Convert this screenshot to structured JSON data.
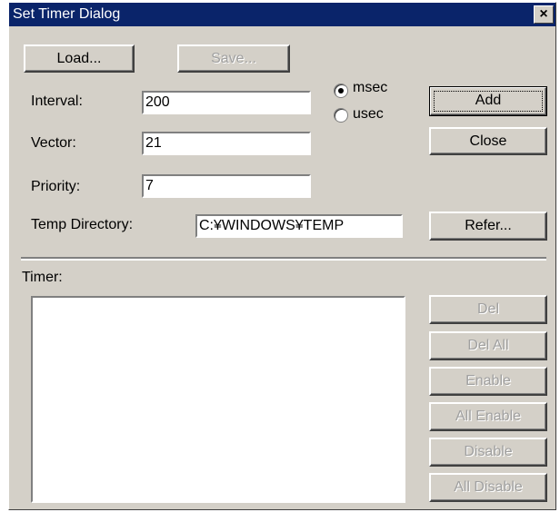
{
  "window": {
    "title": "Set Timer Dialog",
    "close_glyph": "×"
  },
  "buttons": {
    "load": "Load...",
    "save": "Save...",
    "add": "Add",
    "close": "Close",
    "refer": "Refer...",
    "del": "Del",
    "del_all": "Del All",
    "enable": "Enable",
    "all_enable": "All Enable",
    "disable": "Disable",
    "all_disable": "All Disable"
  },
  "fields": {
    "interval": {
      "label": "Interval:",
      "value": "200"
    },
    "vector": {
      "label": "Vector:",
      "value": "21"
    },
    "priority": {
      "label": "Priority:",
      "value": "7"
    },
    "temp_directory": {
      "label": "Temp Directory:",
      "value": "C:¥WINDOWS¥TEMP"
    }
  },
  "units": {
    "options": [
      "msec",
      "usec"
    ],
    "selected": "msec"
  },
  "timer": {
    "label": "Timer:",
    "items": []
  }
}
